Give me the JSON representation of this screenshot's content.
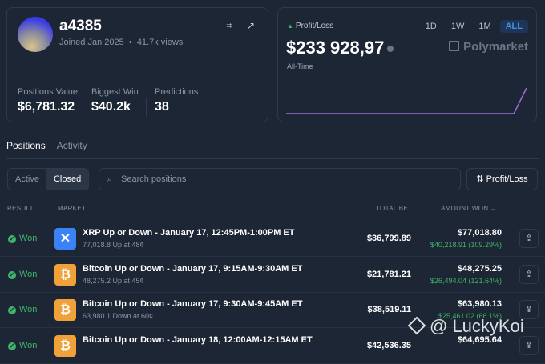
{
  "profile": {
    "username": "a4385",
    "joined": "Joined Jan 2025",
    "views": "41.7k views",
    "stats": [
      {
        "label": "Positions Value",
        "value": "$6,781.32"
      },
      {
        "label": "Biggest Win",
        "value": "$40.2k"
      },
      {
        "label": "Predictions",
        "value": "38"
      }
    ]
  },
  "pnl": {
    "label": "Profit/Loss",
    "value": "$233 928,97",
    "period": "All-Time",
    "ranges": [
      "1D",
      "1W",
      "1M",
      "ALL"
    ],
    "active_range": "ALL",
    "brand": "Polymarket",
    "chart_data": {
      "type": "line",
      "series": [
        {
          "name": "Profit/Loss",
          "values": [
            0,
            0,
            0,
            0,
            0,
            0,
            0,
            0,
            0,
            0,
            0,
            0,
            0,
            0,
            0,
            0,
            0,
            0,
            0,
            233928.97
          ]
        }
      ]
    }
  },
  "tabs": [
    "Positions",
    "Activity"
  ],
  "filter": {
    "segments": [
      "Active",
      "Closed"
    ],
    "search_placeholder": "Search positions",
    "sort_label": "Profit/Loss"
  },
  "table": {
    "headers": {
      "result": "RESULT",
      "market": "MARKET",
      "total_bet": "TOTAL BET",
      "amount_won": "AMOUNT WON"
    },
    "rows": [
      {
        "result": "Won",
        "logo": "xrp",
        "title": "XRP Up or Down - January 17, 12:45PM-1:00PM ET",
        "sub": "77,018.8 Up at 48¢",
        "total_bet": "$36,799.89",
        "amount_won": "$77,018.80",
        "profit": "$40,218.91 (109.29%)"
      },
      {
        "result": "Won",
        "logo": "btc",
        "title": "Bitcoin Up or Down - January 17, 9:15AM-9:30AM ET",
        "sub": "48,275.2 Up at 45¢",
        "total_bet": "$21,781.21",
        "amount_won": "$48,275.25",
        "profit": "$26,494.04 (121.64%)"
      },
      {
        "result": "Won",
        "logo": "btc",
        "title": "Bitcoin Up or Down - January 17, 9:30AM-9:45AM ET",
        "sub": "63,980.1 Down at 60¢",
        "total_bet": "$38,519.11",
        "amount_won": "$63,980.13",
        "profit": "$25,461.02 (66.1%)"
      },
      {
        "result": "Won",
        "logo": "btc",
        "title": "Bitcoin Up or Down - January 18, 12:00AM-12:15AM ET",
        "sub": "",
        "total_bet": "$42,536.35",
        "amount_won": "$64,695.64",
        "profit": ""
      }
    ]
  },
  "watermark": "@ LuckyKoi"
}
